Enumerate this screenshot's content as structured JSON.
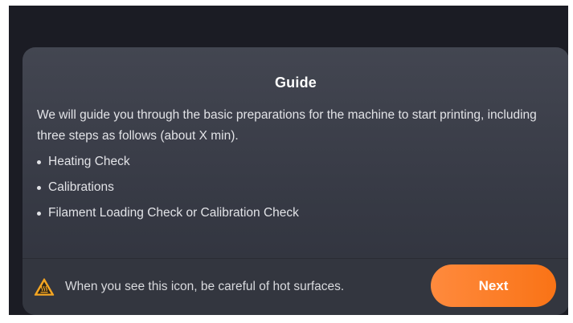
{
  "dialog": {
    "title": "Guide",
    "description": "We will guide you through the basic preparations for the machine to start printing, including three steps as follows (about X min).",
    "steps": [
      "Heating Check",
      "Calibrations",
      "Filament Loading Check or Calibration Check"
    ]
  },
  "footer": {
    "warning_icon": "hot-surface-warning-icon",
    "warning_text": "When you see this icon, be careful of hot surfaces.",
    "next_label": "Next"
  },
  "colors": {
    "background": "#1b1c24",
    "dialog": "#3b3e49",
    "accent": "#f97316",
    "warning": "#f5a623"
  }
}
